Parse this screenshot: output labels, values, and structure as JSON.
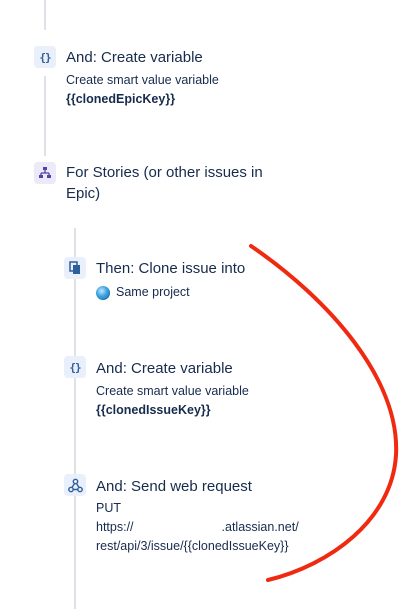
{
  "rules": [
    {
      "icon": "curly-braces-icon",
      "title": "And: Create variable",
      "line1": "Create smart value variable",
      "line2": "{{clonedEpicKey}}"
    },
    {
      "icon": "branch-icon",
      "title": "For Stories (or other issues in",
      "title2": "Epic)"
    },
    {
      "icon": "clone-icon",
      "title": "Then: Clone issue into",
      "project": "Same project"
    },
    {
      "icon": "curly-braces-icon",
      "title": "And: Create variable",
      "line1": "Create smart value variable",
      "line2": "{{clonedIssueKey}}"
    },
    {
      "icon": "webhook-icon",
      "title": "And: Send web request",
      "method": "PUT",
      "url_start": "https://",
      "url_domain": ".atlassian.net/",
      "url_path": "rest/api/3/issue/{{clonedIssueKey}}"
    }
  ],
  "colors": {
    "annotation": "#f02a10",
    "connector": "#dfe1e6",
    "icon_bg": "#e9f0fb",
    "text": "#172b4d"
  }
}
